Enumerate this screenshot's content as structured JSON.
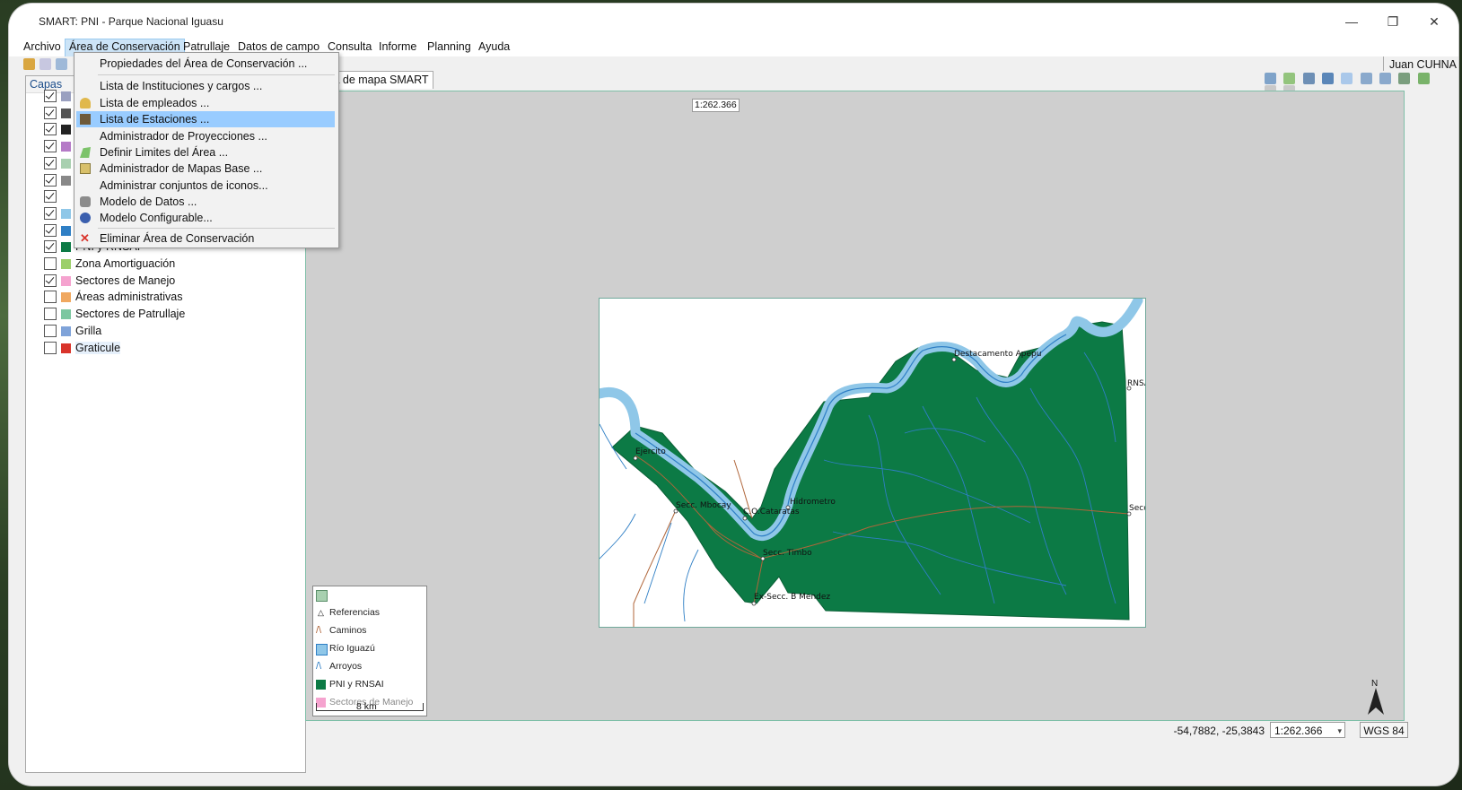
{
  "window": {
    "title": "SMART: PNI - Parque Nacional Iguasu",
    "minimize": "—",
    "maximize": "❐",
    "close": "✕"
  },
  "menubar": [
    "Archivo",
    "Área de Conservación",
    "Patrullaje",
    "Datos de campo",
    "Consulta",
    "Informe",
    "Planning",
    "Ayuda"
  ],
  "user": "Juan CUHNA",
  "dropdown": {
    "items": [
      {
        "label": "Propiedades del Área de Conservación ...",
        "icon": "none"
      },
      {
        "label": "Lista de Instituciones y cargos ...",
        "icon": "none"
      },
      {
        "label": "Lista de empleados ...",
        "icon": "person-icon"
      },
      {
        "label": "Lista de Estaciones ...",
        "icon": "station-icon"
      },
      {
        "label": "Administrador de Proyecciones ...",
        "icon": "none"
      },
      {
        "label": "Definir Limites del Área ...",
        "icon": "polygon-icon"
      },
      {
        "label": "Administrador de Mapas Base ...",
        "icon": "map-icon"
      },
      {
        "label": "Administrar conjuntos de iconos...",
        "icon": "none"
      },
      {
        "label": "Modelo de Datos ...",
        "icon": "database-icon"
      },
      {
        "label": "Modelo Configurable...",
        "icon": "gear-icon"
      },
      {
        "label": "Eliminar Área de Conservación",
        "icon": "delete-icon"
      }
    ],
    "highlighted": "Lista de Estaciones ..."
  },
  "layers": {
    "header": "Capas",
    "items": [
      {
        "label": "",
        "checked": true
      },
      {
        "label": "",
        "checked": true
      },
      {
        "label": "",
        "checked": true
      },
      {
        "label": "",
        "checked": true
      },
      {
        "label": "",
        "checked": true
      },
      {
        "label": "",
        "checked": true
      },
      {
        "label": "",
        "checked": true
      },
      {
        "label": "",
        "checked": true
      },
      {
        "label": "",
        "checked": true
      },
      {
        "label": "PNI y RNSAI",
        "checked": true
      },
      {
        "label": "Zona Amortiguación",
        "checked": false
      },
      {
        "label": "Sectores de Manejo",
        "checked": true
      },
      {
        "label": "Áreas administrativas",
        "checked": false
      },
      {
        "label": "Sectores de Patrullaje",
        "checked": false
      },
      {
        "label": "Grilla",
        "checked": false
      },
      {
        "label": "Graticule",
        "checked": false
      }
    ]
  },
  "map": {
    "tab_label": "ta de mapa SMART",
    "scale_badge": "1:262.366",
    "places": [
      "Destacamento Apepu",
      "RNSAI",
      "Ejercito",
      "Hidrometro",
      "Secc. Mbocay",
      "C.O.Cataratas",
      "Secc. Yacuy",
      "Secc. Timbo",
      "Ex-Secc. B Mendez"
    ],
    "legend": [
      "",
      "Referencias",
      "Caminos",
      "Río Iguazú",
      "Arroyos",
      "PNI y RNSAI",
      "Sectores de Manejo"
    ],
    "scalebar": "8 km",
    "north": "N"
  },
  "status": {
    "coords": "-54,7882, -25,3843",
    "scale": "1:262.366",
    "crs": "WGS 84"
  },
  "colors": {
    "park": "#0c7a45",
    "river": "#8fc7e8",
    "stream": "#2f7fc5",
    "road": "#b0663a",
    "highlight": "#99ccff"
  }
}
